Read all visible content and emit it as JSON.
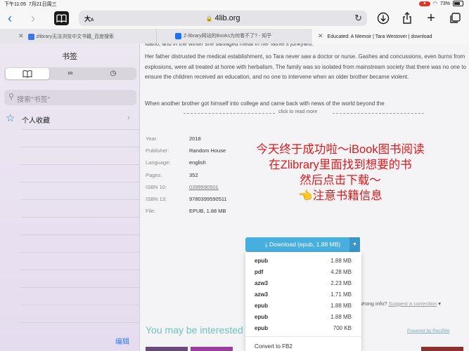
{
  "status_bar": {
    "time": "下午11:05",
    "date": "7月21日周三",
    "battery": "73%"
  },
  "toolbar": {
    "reader_text": "大",
    "url": "4lib.org"
  },
  "tabs": [
    {
      "title": "zlibrary无法浏览中文书籍_百度搜索"
    },
    {
      "title": "Z-library网站的Books为何看不了? - 知乎"
    },
    {
      "title": "Educated: A Memoir | Tara Westover | download"
    }
  ],
  "sidebar": {
    "title": "书签",
    "search_placeholder": "搜索\"书签\"",
    "item": "个人收藏",
    "edit": "编辑"
  },
  "page": {
    "top_fragment": "Idaho, and in the winter she salvaged metal in her father's junkyard.",
    "para1": "Her father distrusted the medical establishment, so Tara never saw a doctor or nurse. Gashes and concussions, even burns from explosions, were all treated at home with herbalism. The family was so isolated from mainstream society that there was no one to ensure the children received an education, and no one to intervene when an older brother became violent.",
    "para2": "When another brother got himself into college and came back with news of the world beyond the",
    "read_more": "click to read more",
    "meta": [
      {
        "label": "Year:",
        "value": "2018"
      },
      {
        "label": "Publisher:",
        "value": "Random House"
      },
      {
        "label": "Language:",
        "value": "english"
      },
      {
        "label": "Pages:",
        "value": "352"
      },
      {
        "label": "ISBN 10:",
        "value": "0399590501"
      },
      {
        "label": "ISBN 13:",
        "value": "9780399590511"
      },
      {
        "label": "File:",
        "value": "EPUB, 1.88 MB"
      }
    ],
    "overlay_lines": [
      "今天终于成功啦～iBook图书阅读",
      "在Zlibrary里面找到想要的书",
      "然后点击下载～",
      "👈注意书籍信息"
    ],
    "download_label": "Download (epub, 1.88 MB)",
    "formats": [
      {
        "fmt": "epub",
        "size": "1.88 MB"
      },
      {
        "fmt": "pdf",
        "size": "4.28 MB"
      },
      {
        "fmt": "azw3",
        "size": "2.23 MB"
      },
      {
        "fmt": "azw3",
        "size": "1.71 MB"
      },
      {
        "fmt": "epub",
        "size": "1.88 MB"
      },
      {
        "fmt": "epub",
        "size": "1.88 MB"
      },
      {
        "fmt": "epub",
        "size": "700 KB"
      }
    ],
    "convert_label": "Convert to FB2",
    "wrong_prefix": "Wrong info?",
    "wrong_link": "Suggest a correction",
    "interested": "You may be interested",
    "powered": "Powered by Rec2Me"
  }
}
